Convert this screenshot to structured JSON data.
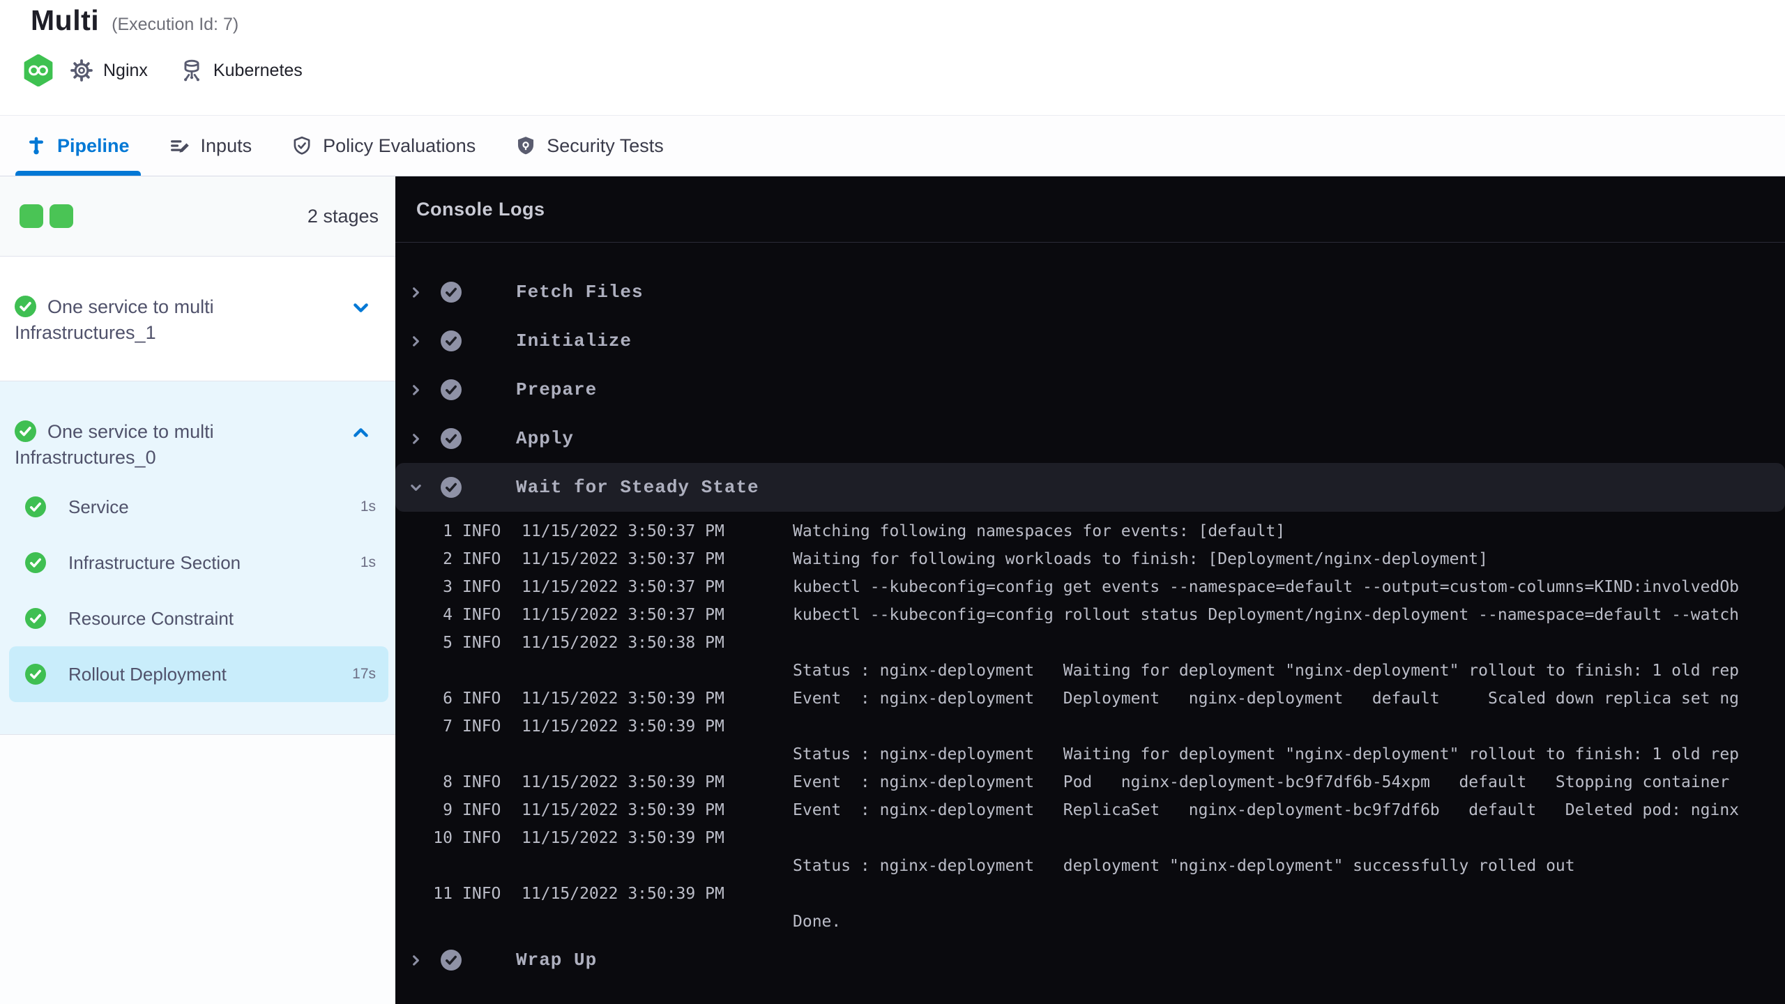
{
  "header": {
    "title": "Multi",
    "execution_id": "(Execution Id: 7)",
    "service_label": "Nginx",
    "infra_label": "Kubernetes"
  },
  "tabs": [
    {
      "label": "Pipeline",
      "active": true
    },
    {
      "label": "Inputs",
      "active": false
    },
    {
      "label": "Policy Evaluations",
      "active": false
    },
    {
      "label": "Security Tests",
      "active": false
    }
  ],
  "sidebar": {
    "stages_count": "2 stages",
    "stages": [
      {
        "name": "One service to multi Infrastructures_1",
        "status": "success",
        "expanded": false,
        "steps": []
      },
      {
        "name": "One service to multi Infrastructures_0",
        "status": "success",
        "expanded": true,
        "steps": [
          {
            "label": "Service",
            "duration": "1s",
            "status": "success",
            "selected": false
          },
          {
            "label": "Infrastructure Section",
            "duration": "1s",
            "status": "success",
            "selected": false
          },
          {
            "label": "Resource Constraint",
            "duration": "",
            "status": "success",
            "selected": false
          },
          {
            "label": "Rollout Deployment",
            "duration": "17s",
            "status": "success",
            "selected": true
          }
        ]
      }
    ]
  },
  "console": {
    "title": "Console Logs",
    "steps": [
      {
        "label": "Fetch Files",
        "status": "success",
        "expanded": false
      },
      {
        "label": "Initialize",
        "status": "success",
        "expanded": false
      },
      {
        "label": "Prepare",
        "status": "success",
        "expanded": false
      },
      {
        "label": "Apply",
        "status": "success",
        "expanded": false
      },
      {
        "label": "Wait for Steady State",
        "status": "success",
        "expanded": true,
        "selected": true,
        "logs": [
          {
            "num": "1",
            "level": "INFO",
            "time": "11/15/2022 3:50:37 PM",
            "msg": "Watching following namespaces for events: [default]"
          },
          {
            "num": "2",
            "level": "INFO",
            "time": "11/15/2022 3:50:37 PM",
            "msg": "Waiting for following workloads to finish: [Deployment/nginx-deployment]"
          },
          {
            "num": "3",
            "level": "INFO",
            "time": "11/15/2022 3:50:37 PM",
            "msg": "kubectl --kubeconfig=config get events --namespace=default --output=custom-columns=KIND:involvedOb"
          },
          {
            "num": "4",
            "level": "INFO",
            "time": "11/15/2022 3:50:37 PM",
            "msg": "kubectl --kubeconfig=config rollout status Deployment/nginx-deployment --namespace=default --watch"
          },
          {
            "num": "5",
            "level": "INFO",
            "time": "11/15/2022 3:50:38 PM",
            "msg": ""
          },
          {
            "num": "",
            "level": "",
            "time": "",
            "msg": "Status : nginx-deployment   Waiting for deployment \"nginx-deployment\" rollout to finish: 1 old rep"
          },
          {
            "num": "6",
            "level": "INFO",
            "time": "11/15/2022 3:50:39 PM",
            "msg": "Event  : nginx-deployment   Deployment   nginx-deployment   default     Scaled down replica set ng"
          },
          {
            "num": "7",
            "level": "INFO",
            "time": "11/15/2022 3:50:39 PM",
            "msg": ""
          },
          {
            "num": "",
            "level": "",
            "time": "",
            "msg": "Status : nginx-deployment   Waiting for deployment \"nginx-deployment\" rollout to finish: 1 old rep"
          },
          {
            "num": "8",
            "level": "INFO",
            "time": "11/15/2022 3:50:39 PM",
            "msg": "Event  : nginx-deployment   Pod   nginx-deployment-bc9f7df6b-54xpm   default   Stopping container"
          },
          {
            "num": "9",
            "level": "INFO",
            "time": "11/15/2022 3:50:39 PM",
            "msg": "Event  : nginx-deployment   ReplicaSet   nginx-deployment-bc9f7df6b   default   Deleted pod: nginx"
          },
          {
            "num": "10",
            "level": "INFO",
            "time": "11/15/2022 3:50:39 PM",
            "msg": ""
          },
          {
            "num": "",
            "level": "",
            "time": "",
            "msg": "Status : nginx-deployment   deployment \"nginx-deployment\" successfully rolled out"
          },
          {
            "num": "11",
            "level": "INFO",
            "time": "11/15/2022 3:50:39 PM",
            "msg": ""
          },
          {
            "num": "",
            "level": "",
            "time": "",
            "msg": "Done."
          }
        ]
      },
      {
        "label": "Wrap Up",
        "status": "success",
        "expanded": false
      }
    ]
  },
  "colors": {
    "accent_blue": "#0278d5",
    "success_green": "#4ac455",
    "selected_step_bg": "#c9edfb",
    "stage_group_bg": "#e9f6fd",
    "console_bg": "#0a0a0e",
    "console_selected_row": "#1d1e26"
  }
}
